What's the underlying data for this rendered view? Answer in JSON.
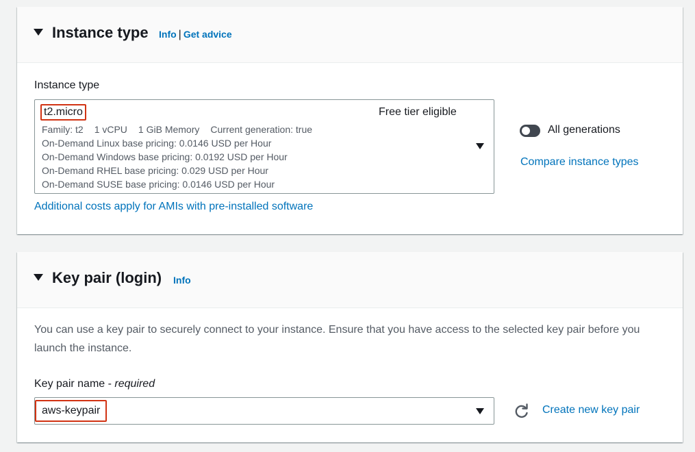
{
  "instance_type": {
    "title": "Instance type",
    "info_link": "Info",
    "separator": "|",
    "advice_link": "Get advice",
    "field_label": "Instance type",
    "selected": {
      "name": "t2.micro",
      "badge": "Free tier eligible",
      "specs": [
        "Family: t2",
        "1 vCPU",
        "1 GiB Memory",
        "Current generation: true"
      ],
      "pricing": [
        "On-Demand Linux base pricing: 0.0146 USD per Hour",
        "On-Demand Windows base pricing: 0.0192 USD per Hour",
        "On-Demand RHEL base pricing: 0.029 USD per Hour",
        "On-Demand SUSE base pricing: 0.0146 USD per Hour"
      ]
    },
    "additional_costs_link": "Additional costs apply for AMIs with pre-installed software",
    "toggle_label": "All generations",
    "toggle_on": false,
    "compare_link": "Compare instance types"
  },
  "key_pair": {
    "title": "Key pair (login)",
    "info_link": "Info",
    "description": "You can use a key pair to securely connect to your instance. Ensure that you have access to the selected key pair before you launch the instance.",
    "field_label": "Key pair name",
    "field_label_suffix": " - ",
    "required_text": "required",
    "selected_value": "aws-keypair",
    "create_link": "Create new key pair"
  },
  "colors": {
    "link": "#0073bb",
    "highlight": "#d13212",
    "toggle_off": "#414750"
  }
}
